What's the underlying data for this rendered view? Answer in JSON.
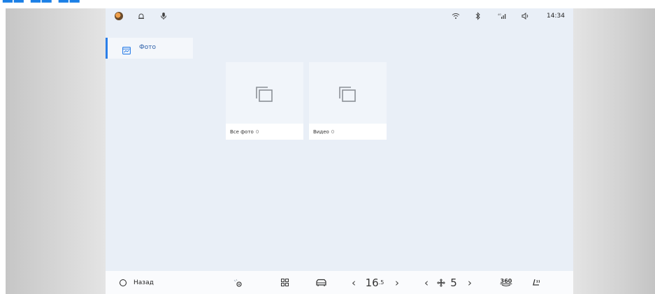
{
  "status_bar": {
    "time": "14:34",
    "icons": [
      "avatar-icon",
      "bell-icon",
      "mic-icon",
      "wifi-icon",
      "bluetooth-icon",
      "cellular-signal-icon",
      "volume-icon"
    ]
  },
  "sidebar": {
    "items": [
      {
        "label": "Фото",
        "icon": "photo-gallery-icon",
        "active": true
      }
    ]
  },
  "albums": [
    {
      "label": "Все фото",
      "count": "0",
      "icon": "album-stack-icon"
    },
    {
      "label": "Видео",
      "count": "0",
      "icon": "album-stack-icon"
    }
  ],
  "dock": {
    "back_label": "Назад",
    "temperature_main": "16",
    "temperature_decimal": ".5",
    "fan_level": "5",
    "view_360_label": "360",
    "accent": "#2a7ee8"
  }
}
